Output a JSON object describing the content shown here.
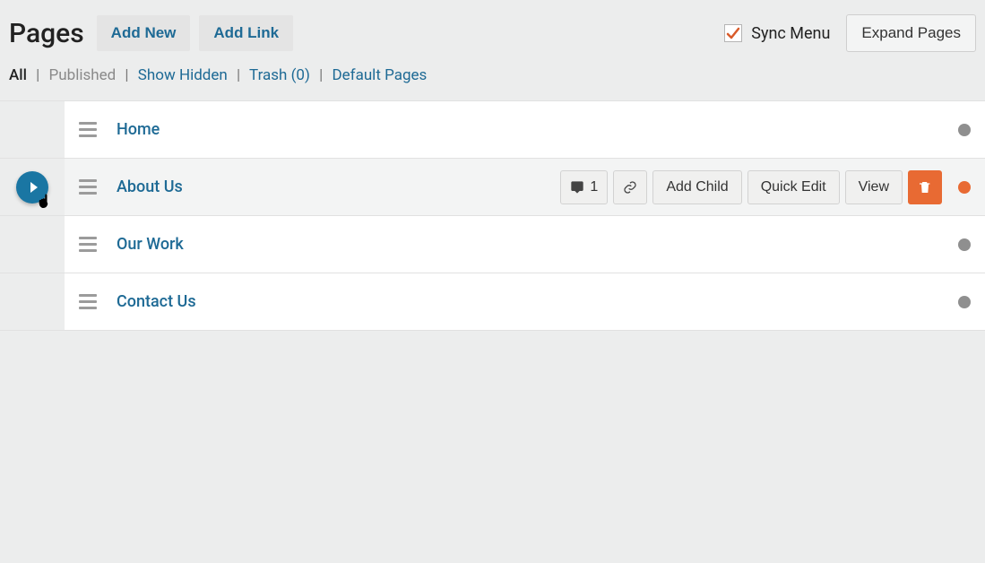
{
  "header": {
    "title": "Pages",
    "add_new": "Add New",
    "add_link": "Add Link",
    "sync_menu": "Sync Menu",
    "sync_checked": true,
    "expand_pages": "Expand Pages"
  },
  "filters": {
    "all": "All",
    "published": "Published",
    "show_hidden": "Show Hidden",
    "trash": "Trash (0)",
    "default_pages": "Default Pages"
  },
  "row_actions": {
    "comments_count": "1",
    "add_child": "Add Child",
    "quick_edit": "Quick Edit",
    "view": "View"
  },
  "pages": [
    {
      "name": "Home",
      "status": "gray",
      "hovered": false,
      "has_children": false
    },
    {
      "name": "About Us",
      "status": "orange",
      "hovered": true,
      "has_children": true
    },
    {
      "name": "Our Work",
      "status": "gray",
      "hovered": false,
      "has_children": false
    },
    {
      "name": "Contact Us",
      "status": "gray",
      "hovered": false,
      "has_children": false
    }
  ]
}
